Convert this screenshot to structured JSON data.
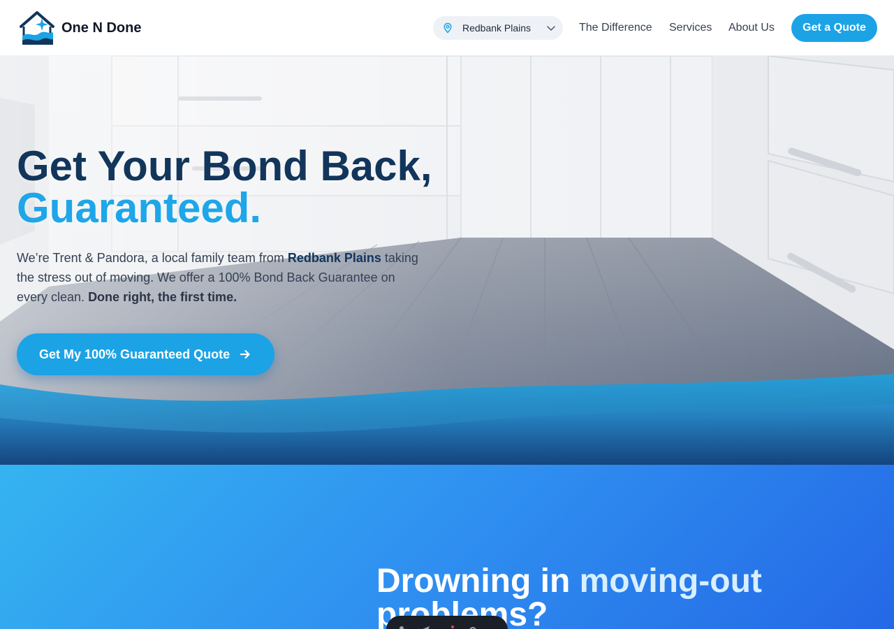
{
  "brand": {
    "name": "One N Done"
  },
  "header": {
    "location_select": {
      "value": "Redbank Plains"
    },
    "nav": [
      {
        "label": "The Difference"
      },
      {
        "label": "Services"
      },
      {
        "label": "About Us"
      }
    ],
    "cta_label": "Get a Quote"
  },
  "hero": {
    "title_line1": "Get Your Bond Back,",
    "title_line2": "Guaranteed.",
    "text_part1": "We’re Trent & Pandora, a local family team from ",
    "text_highlight": "Redbank Plains",
    "text_part2": " taking the stress out of moving. We offer a 100% Bond Back Guarantee on every clean. ",
    "text_strong": "Done right, the first time.",
    "cta_label": "Get My 100% Guaranteed Quote"
  },
  "section2": {
    "title_part1": "Drowning in ",
    "title_accent": "moving-out",
    "title_part2": " problems?"
  },
  "colors": {
    "brand_blue": "#1ba3e6",
    "navy": "#12355b",
    "section_gradient_start": "#35b4f0",
    "section_gradient_end": "#2468e6"
  },
  "icons": {
    "location": "map-pin-icon",
    "dropdown": "chevron-down-icon",
    "cta_arrow": "arrow-right-icon",
    "logo": "house-wave-sparkle-logo"
  }
}
